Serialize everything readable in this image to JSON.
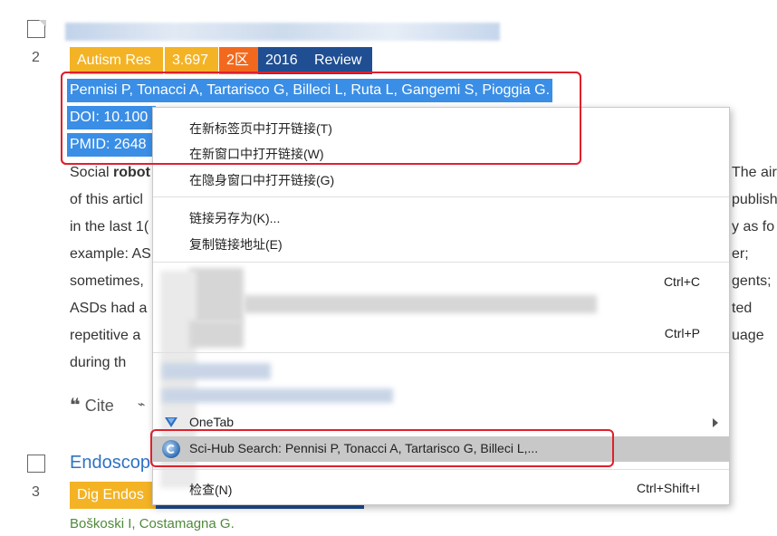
{
  "row2": {
    "number": "2",
    "badges": {
      "journal": "Autism Res",
      "impact_factor": "3.697",
      "zone": "2区",
      "year": "2016",
      "type": "Review"
    },
    "authors": "Pennisi P, Tonacci A, Tartarisco G, Billeci L, Ruta L, Gangemi S, Pioggia G.",
    "doi_visible": "DOI: 10.100",
    "pmid_visible": "PMID: 2648",
    "abstract_left": [
      "Social robot",
      "of this articl",
      "in the last 1(",
      "example: AS",
      "sometimes,",
      "ASDs had a",
      "repetitive a",
      "during th"
    ],
    "abstract_right": [
      "The air",
      "publish",
      "y as fo",
      "er;",
      "gents;",
      "ted",
      "uage",
      ""
    ],
    "cite_label": "Cite"
  },
  "row3": {
    "number": "3",
    "title_visible": "Endoscop",
    "journal_visible": "Dig Endos",
    "authors": "Boškoski I, Costamagna G."
  },
  "context_menu": {
    "items": [
      {
        "label": "在新标签页中打开链接(T)",
        "shortcut": ""
      },
      {
        "label": "在新窗口中打开链接(W)",
        "shortcut": ""
      },
      {
        "label": "在隐身窗口中打开链接(G)",
        "shortcut": ""
      },
      {
        "label": "链接另存为(K)...",
        "shortcut": ""
      },
      {
        "label": "复制链接地址(E)",
        "shortcut": ""
      },
      {
        "label": "",
        "shortcut": "Ctrl+C"
      },
      {
        "label": "",
        "shortcut": "Ctrl+P"
      },
      {
        "label": "OneTab",
        "shortcut": ""
      },
      {
        "label": "Sci-Hub Search: Pennisi P, Tonacci A, Tartarisco G, Billeci L,...",
        "shortcut": ""
      },
      {
        "label": "检查(N)",
        "shortcut": "Ctrl+Shift+I"
      }
    ],
    "highlight_color": "#c8c8c8"
  },
  "colors": {
    "selection": "#3a8ee6",
    "annotation_box": "#e0202c",
    "journal_badge": "#f3b325",
    "zone_badge": "#f2691e",
    "year_badge": "#1f4e92"
  }
}
